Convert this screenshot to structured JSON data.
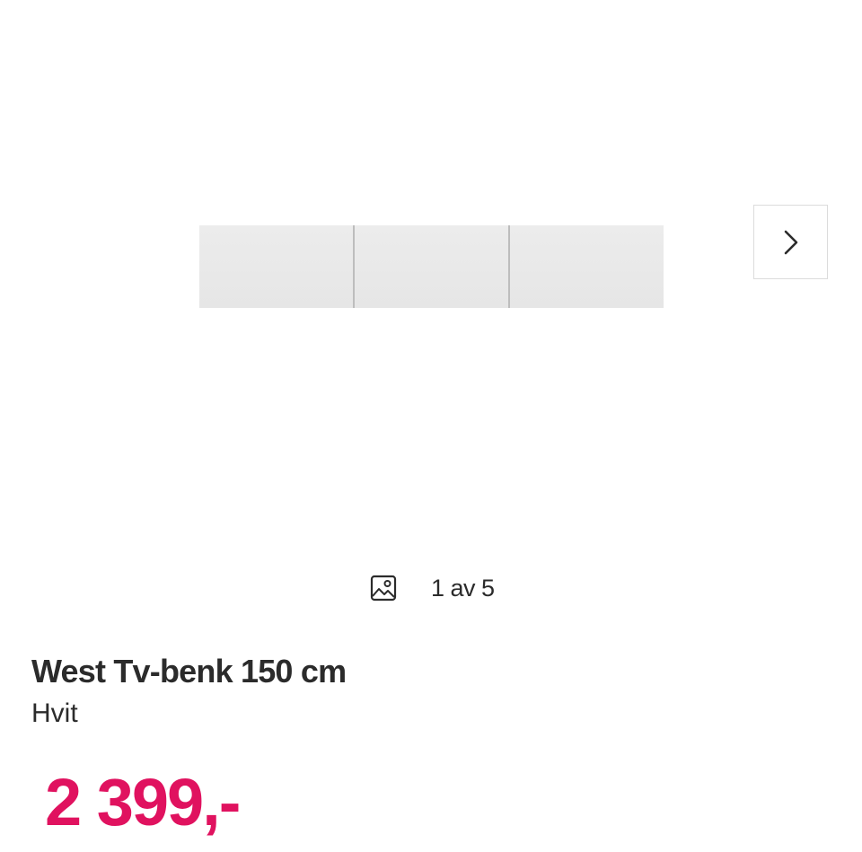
{
  "gallery": {
    "image_alt": "West Tv-benk 150 cm",
    "next_icon": "chevron-right-icon",
    "counter_icon": "image-icon",
    "counter_text": "1 av 5",
    "current": 1,
    "total": 5
  },
  "product": {
    "title": "West Tv-benk 150 cm",
    "variant": "Hvit",
    "price": "2 399,-"
  },
  "colors": {
    "price": "#e0125f",
    "text": "#2b2b2b",
    "border": "#dcdcdc"
  }
}
